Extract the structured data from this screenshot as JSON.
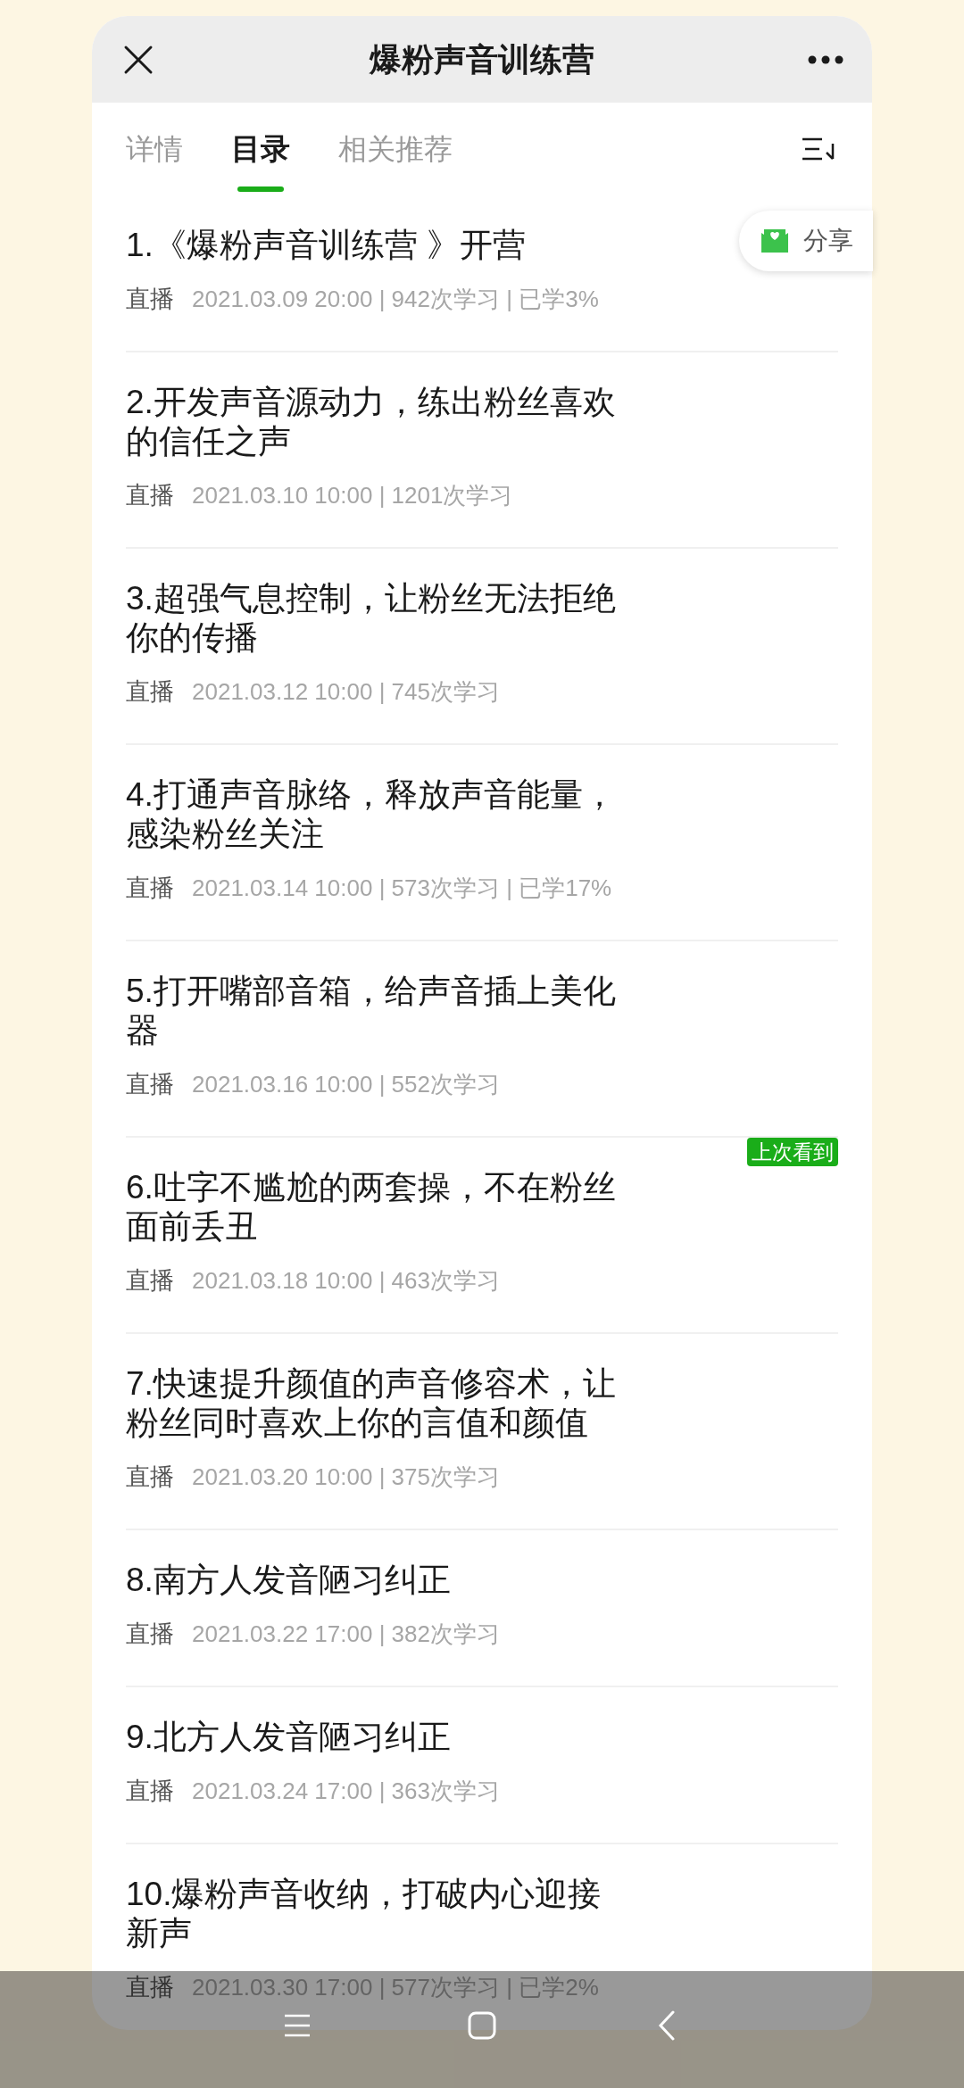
{
  "header": {
    "title": "爆粉声音训练营"
  },
  "tabs": [
    {
      "label": "详情",
      "selected": false
    },
    {
      "label": "目录",
      "selected": true
    },
    {
      "label": "相关推荐",
      "selected": false
    }
  ],
  "share_button": {
    "label": "分享"
  },
  "lessons": [
    {
      "title": "1.《爆粉声音训练营 》开营",
      "type": "直播",
      "info": "2021.03.09 20:00 | 942次学习 | 已学3%"
    },
    {
      "title": "2.开发声音源动力，练出粉丝喜欢的信任之声",
      "type": "直播",
      "info": "2021.03.10 10:00 | 1201次学习"
    },
    {
      "title": "3.超强气息控制，让粉丝无法拒绝你的传播",
      "type": "直播",
      "info": "2021.03.12 10:00 | 745次学习"
    },
    {
      "title": "4.打通声音脉络，释放声音能量，感染粉丝关注",
      "type": "直播",
      "info": "2021.03.14 10:00 | 573次学习 | 已学17%"
    },
    {
      "title": "5.打开嘴部音箱，给声音插上美化器",
      "type": "直播",
      "info": "2021.03.16 10:00 | 552次学习"
    },
    {
      "title": "6.吐字不尴尬的两套操，不在粉丝面前丢丑",
      "type": "直播",
      "info": "2021.03.18 10:00 | 463次学习",
      "badge": "上次看到"
    },
    {
      "title": "7.快速提升颜值的声音修容术，让粉丝同时喜欢上你的言值和颜值",
      "type": "直播",
      "info": "2021.03.20 10:00 | 375次学习"
    },
    {
      "title": "8.南方人发音陋习纠正",
      "type": "直播",
      "info": "2021.03.22 17:00 | 382次学习"
    },
    {
      "title": "9.北方人发音陋习纠正",
      "type": "直播",
      "info": "2021.03.24 17:00 | 363次学习"
    },
    {
      "title": "10.爆粉声音收纳，打破内心迎接新声",
      "type": "直播",
      "info": "2021.03.30 17:00 | 577次学习 | 已学2%"
    }
  ]
}
